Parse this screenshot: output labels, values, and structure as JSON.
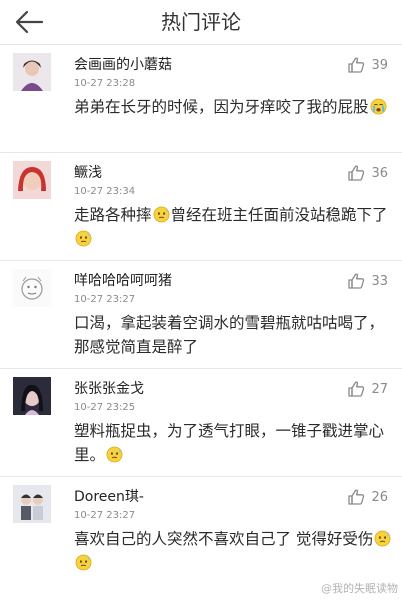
{
  "header": {
    "title": "热门评论"
  },
  "comments": [
    {
      "user": "会画画的小蘑菇",
      "time": "10-27 23:28",
      "likes": "39",
      "text_a": "弟弟在长牙的时候，因为牙痒咬了我的屁股",
      "text_b": "",
      "text_c": "",
      "emoji": [
        "cry-emoji"
      ]
    },
    {
      "user": "鳜浅",
      "time": "10-27 23:34",
      "likes": "36",
      "text_a": "走路各种摔",
      "text_b": "曾经在班主任面前没站稳跪下了",
      "text_c": "",
      "emoji": [
        "awkward-emoji",
        "awkward-emoji"
      ]
    },
    {
      "user": "咩哈哈哈呵呵猪",
      "time": "10-27 23:27",
      "likes": "33",
      "text_a": "口渴，拿起装着空调水的雪碧瓶就咕咕喝了，那感觉简直是醉了",
      "text_b": "",
      "text_c": "",
      "emoji": []
    },
    {
      "user": "张张张金戈",
      "time": "10-27 23:25",
      "likes": "27",
      "text_a": "塑料瓶捉虫，为了透气打眼，一锥子戳进掌心里。",
      "text_b": "",
      "text_c": "",
      "emoji": [
        "awkward-emoji"
      ]
    },
    {
      "user": "Doreen琪-",
      "time": "10-27 23:27",
      "likes": "26",
      "text_a": "喜欢自己的人突然不喜欢自己了 觉得好受伤",
      "text_b": "",
      "text_c": "",
      "emoji": [
        "awkward-emoji",
        "awkward-emoji"
      ]
    }
  ],
  "watermark": "@我的失眠读物",
  "icons": {
    "back": "arrow-left-icon",
    "like": "thumbs-up-icon"
  },
  "colors": {
    "accent_text": "#333333",
    "meta": "#8a8a8a",
    "divider": "#e8e8e8"
  }
}
